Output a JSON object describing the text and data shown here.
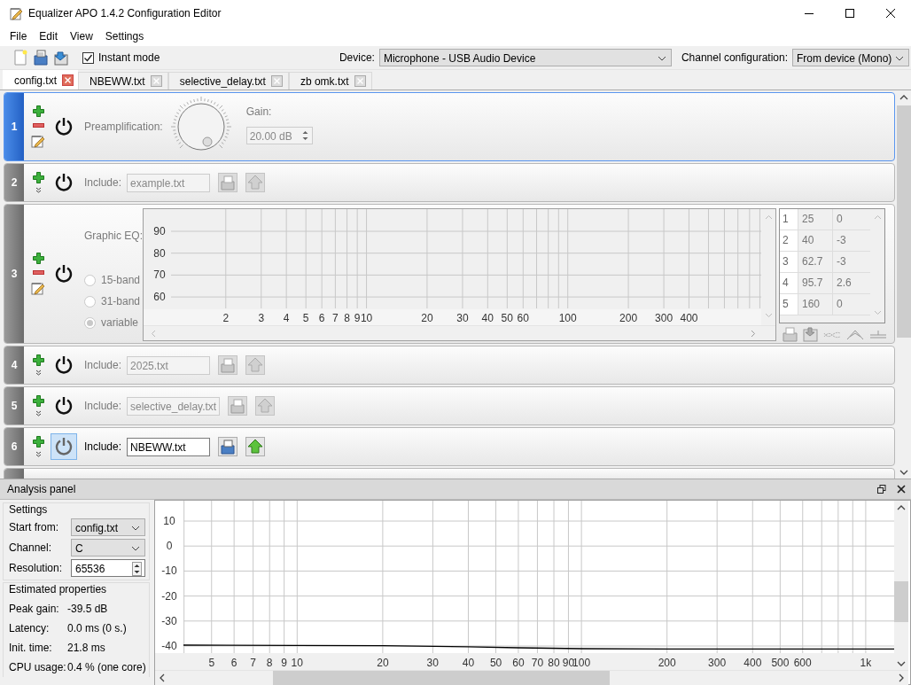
{
  "window": {
    "title": "Equalizer APO 1.4.2 Configuration Editor"
  },
  "menu": [
    "File",
    "Edit",
    "View",
    "Settings"
  ],
  "toolbar": {
    "instant_mode": {
      "label": "Instant mode",
      "checked": true
    },
    "device": {
      "label": "Device:",
      "value": "Microphone - USB Audio Device"
    },
    "channel_configuration": {
      "label": "Channel configuration:",
      "value": "From device (Mono)"
    }
  },
  "tabs": [
    {
      "label": "config.txt",
      "selected": true
    },
    {
      "label": "NBEWW.txt",
      "selected": false
    },
    {
      "label": "selective_delay.txt",
      "selected": false
    },
    {
      "label": "zb omk.txt",
      "selected": false
    }
  ],
  "filters": [
    {
      "number": "1",
      "kind": "preamp",
      "selected": true,
      "label": "Preamplification:",
      "gain_label": "Gain:",
      "gain": "20.00 dB"
    },
    {
      "number": "2",
      "kind": "include",
      "selected": false,
      "label": "Include:",
      "file": "example.txt",
      "active": false,
      "power_highlighted": false
    },
    {
      "number": "3",
      "kind": "graphic_eq",
      "selected": false,
      "label": "Graphic EQ:",
      "modes": [
        {
          "label": "15-band",
          "selected": false
        },
        {
          "label": "31-band",
          "selected": false
        },
        {
          "label": "variable",
          "selected": true
        }
      ],
      "graph": {
        "y_labels": [
          "90",
          "80",
          "70",
          "60"
        ],
        "x_labels": [
          "2",
          "3",
          "4",
          "5",
          "6",
          "7",
          "8",
          "9",
          "10",
          "20",
          "30",
          "40",
          "50",
          "60",
          "100",
          "200",
          "300",
          "400"
        ]
      },
      "bands": [
        {
          "index": "1",
          "frequency": "25",
          "gain": "0"
        },
        {
          "index": "2",
          "frequency": "40",
          "gain": "-3"
        },
        {
          "index": "3",
          "frequency": "62.7",
          "gain": "-3"
        },
        {
          "index": "4",
          "frequency": "95.7",
          "gain": "2.6"
        },
        {
          "index": "5",
          "frequency": "160",
          "gain": "0"
        }
      ]
    },
    {
      "number": "4",
      "kind": "include",
      "selected": false,
      "label": "Include:",
      "file": "2025.txt",
      "active": false,
      "power_highlighted": false
    },
    {
      "number": "5",
      "kind": "include",
      "selected": false,
      "label": "Include:",
      "file": "selective_delay.txt",
      "active": false,
      "power_highlighted": false
    },
    {
      "number": "6",
      "kind": "include",
      "selected": false,
      "label": "Include:",
      "file": "NBEWW.txt",
      "active": true,
      "power_highlighted": true
    }
  ],
  "analysis": {
    "title": "Analysis panel",
    "settings": {
      "title": "Settings",
      "start_from": {
        "label": "Start from:",
        "value": "config.txt"
      },
      "channel": {
        "label": "Channel:",
        "value": "C"
      },
      "resolution": {
        "label": "Resolution:",
        "value": "65536"
      }
    },
    "estimated": {
      "title": "Estimated properties",
      "rows": [
        {
          "label": "Peak gain:",
          "value": "-39.5 dB"
        },
        {
          "label": "Latency:",
          "value": "0.0 ms (0 s.)"
        },
        {
          "label": "Init. time:",
          "value": "21.8 ms"
        },
        {
          "label": "CPU usage:",
          "value": "0.4 % (one core)"
        }
      ]
    },
    "graph": {
      "y_labels": [
        "10",
        "0",
        "-10",
        "-20",
        "-30",
        "-40"
      ],
      "x_labels": [
        "5",
        "6",
        "7",
        "8",
        "9",
        "10",
        "20",
        "30",
        "40",
        "50",
        "60",
        "70",
        "80",
        "90",
        "100",
        "200",
        "300",
        "400",
        "500",
        "600",
        "1k"
      ]
    }
  }
}
